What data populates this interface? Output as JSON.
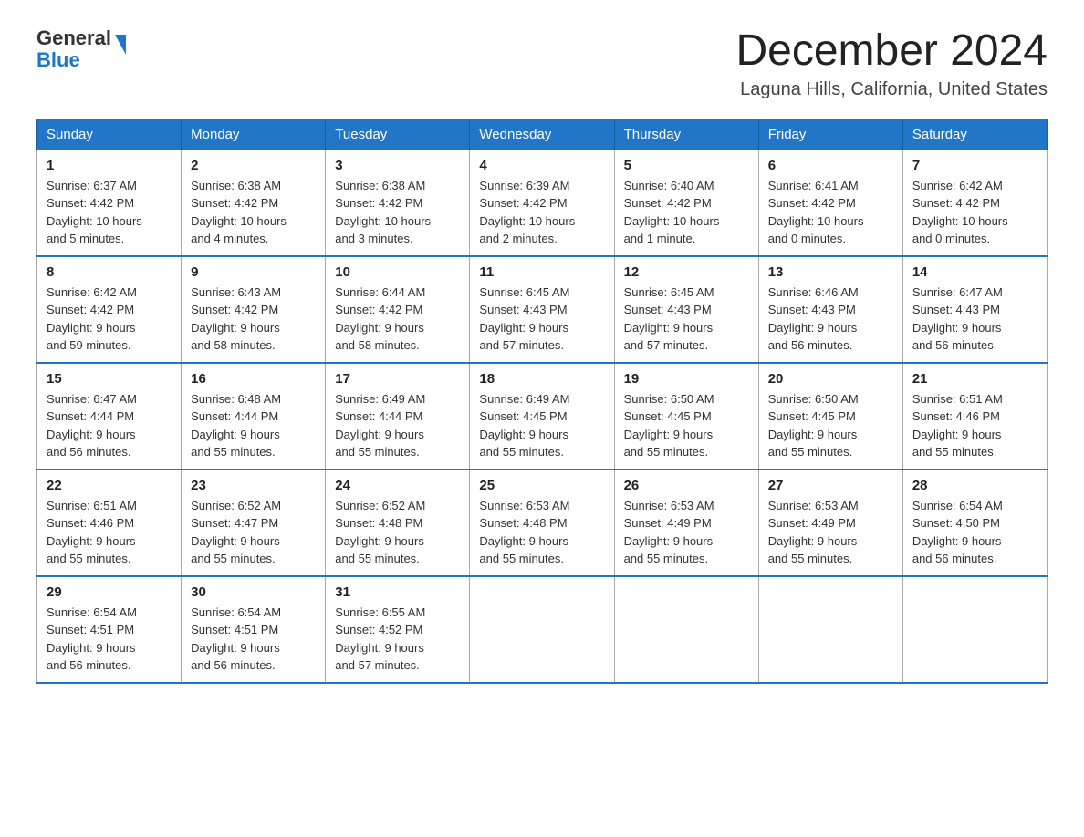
{
  "header": {
    "logo_line1": "General",
    "logo_line2": "Blue",
    "month_title": "December 2024",
    "location": "Laguna Hills, California, United States"
  },
  "days_of_week": [
    "Sunday",
    "Monday",
    "Tuesday",
    "Wednesday",
    "Thursday",
    "Friday",
    "Saturday"
  ],
  "weeks": [
    [
      {
        "day": "1",
        "sunrise": "6:37 AM",
        "sunset": "4:42 PM",
        "daylight": "10 hours and 5 minutes."
      },
      {
        "day": "2",
        "sunrise": "6:38 AM",
        "sunset": "4:42 PM",
        "daylight": "10 hours and 4 minutes."
      },
      {
        "day": "3",
        "sunrise": "6:38 AM",
        "sunset": "4:42 PM",
        "daylight": "10 hours and 3 minutes."
      },
      {
        "day": "4",
        "sunrise": "6:39 AM",
        "sunset": "4:42 PM",
        "daylight": "10 hours and 2 minutes."
      },
      {
        "day": "5",
        "sunrise": "6:40 AM",
        "sunset": "4:42 PM",
        "daylight": "10 hours and 1 minute."
      },
      {
        "day": "6",
        "sunrise": "6:41 AM",
        "sunset": "4:42 PM",
        "daylight": "10 hours and 0 minutes."
      },
      {
        "day": "7",
        "sunrise": "6:42 AM",
        "sunset": "4:42 PM",
        "daylight": "10 hours and 0 minutes."
      }
    ],
    [
      {
        "day": "8",
        "sunrise": "6:42 AM",
        "sunset": "4:42 PM",
        "daylight": "9 hours and 59 minutes."
      },
      {
        "day": "9",
        "sunrise": "6:43 AM",
        "sunset": "4:42 PM",
        "daylight": "9 hours and 58 minutes."
      },
      {
        "day": "10",
        "sunrise": "6:44 AM",
        "sunset": "4:42 PM",
        "daylight": "9 hours and 58 minutes."
      },
      {
        "day": "11",
        "sunrise": "6:45 AM",
        "sunset": "4:43 PM",
        "daylight": "9 hours and 57 minutes."
      },
      {
        "day": "12",
        "sunrise": "6:45 AM",
        "sunset": "4:43 PM",
        "daylight": "9 hours and 57 minutes."
      },
      {
        "day": "13",
        "sunrise": "6:46 AM",
        "sunset": "4:43 PM",
        "daylight": "9 hours and 56 minutes."
      },
      {
        "day": "14",
        "sunrise": "6:47 AM",
        "sunset": "4:43 PM",
        "daylight": "9 hours and 56 minutes."
      }
    ],
    [
      {
        "day": "15",
        "sunrise": "6:47 AM",
        "sunset": "4:44 PM",
        "daylight": "9 hours and 56 minutes."
      },
      {
        "day": "16",
        "sunrise": "6:48 AM",
        "sunset": "4:44 PM",
        "daylight": "9 hours and 55 minutes."
      },
      {
        "day": "17",
        "sunrise": "6:49 AM",
        "sunset": "4:44 PM",
        "daylight": "9 hours and 55 minutes."
      },
      {
        "day": "18",
        "sunrise": "6:49 AM",
        "sunset": "4:45 PM",
        "daylight": "9 hours and 55 minutes."
      },
      {
        "day": "19",
        "sunrise": "6:50 AM",
        "sunset": "4:45 PM",
        "daylight": "9 hours and 55 minutes."
      },
      {
        "day": "20",
        "sunrise": "6:50 AM",
        "sunset": "4:45 PM",
        "daylight": "9 hours and 55 minutes."
      },
      {
        "day": "21",
        "sunrise": "6:51 AM",
        "sunset": "4:46 PM",
        "daylight": "9 hours and 55 minutes."
      }
    ],
    [
      {
        "day": "22",
        "sunrise": "6:51 AM",
        "sunset": "4:46 PM",
        "daylight": "9 hours and 55 minutes."
      },
      {
        "day": "23",
        "sunrise": "6:52 AM",
        "sunset": "4:47 PM",
        "daylight": "9 hours and 55 minutes."
      },
      {
        "day": "24",
        "sunrise": "6:52 AM",
        "sunset": "4:48 PM",
        "daylight": "9 hours and 55 minutes."
      },
      {
        "day": "25",
        "sunrise": "6:53 AM",
        "sunset": "4:48 PM",
        "daylight": "9 hours and 55 minutes."
      },
      {
        "day": "26",
        "sunrise": "6:53 AM",
        "sunset": "4:49 PM",
        "daylight": "9 hours and 55 minutes."
      },
      {
        "day": "27",
        "sunrise": "6:53 AM",
        "sunset": "4:49 PM",
        "daylight": "9 hours and 55 minutes."
      },
      {
        "day": "28",
        "sunrise": "6:54 AM",
        "sunset": "4:50 PM",
        "daylight": "9 hours and 56 minutes."
      }
    ],
    [
      {
        "day": "29",
        "sunrise": "6:54 AM",
        "sunset": "4:51 PM",
        "daylight": "9 hours and 56 minutes."
      },
      {
        "day": "30",
        "sunrise": "6:54 AM",
        "sunset": "4:51 PM",
        "daylight": "9 hours and 56 minutes."
      },
      {
        "day": "31",
        "sunrise": "6:55 AM",
        "sunset": "4:52 PM",
        "daylight": "9 hours and 57 minutes."
      },
      null,
      null,
      null,
      null
    ]
  ],
  "labels": {
    "sunrise_prefix": "Sunrise: ",
    "sunset_prefix": "Sunset: ",
    "daylight_prefix": "Daylight: "
  }
}
